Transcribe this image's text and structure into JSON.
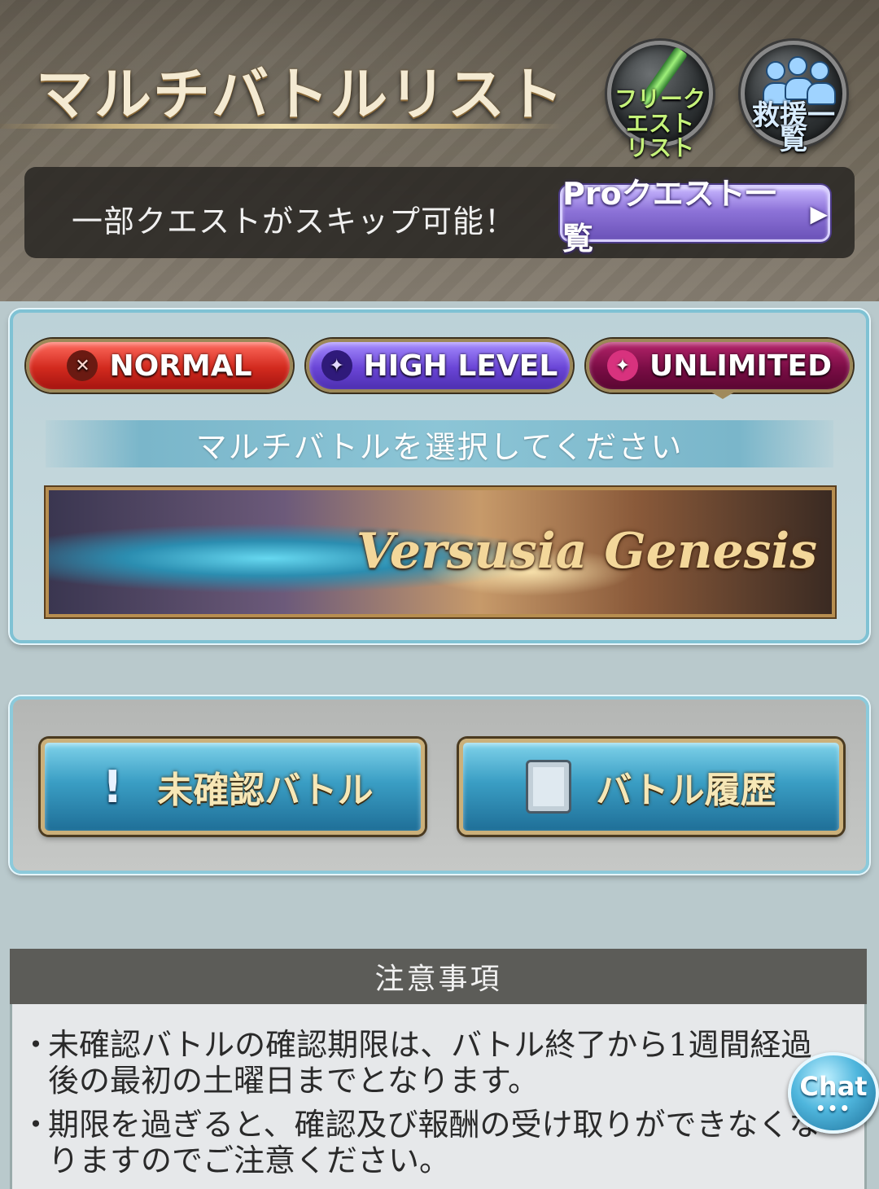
{
  "header": {
    "title": "マルチバトルリスト",
    "free_quest_label": "フリークエスト\nリスト",
    "rescue_label": "救援一覧"
  },
  "skip_bar": {
    "text": "一部クエストがスキップ可能！",
    "pro_button_label": "Proクエスト一覧",
    "pro_button_arrow": "▶"
  },
  "tabs": [
    {
      "label": "NORMAL",
      "icon": "crossed-swords-icon",
      "color": "#d22a1e"
    },
    {
      "label": "HIGH LEVEL",
      "icon": "dragon-icon",
      "color": "#6a45d6"
    },
    {
      "label": "UNLIMITED",
      "icon": "dragon-icon",
      "color": "#7a0d45",
      "selected": true
    }
  ],
  "select_prompt": "マルチバトルを選択してください",
  "event_banner": {
    "title": "Versusia Genesis"
  },
  "actions": {
    "unconfirmed_label": "未確認バトル",
    "history_label": "バトル履歴"
  },
  "notes": {
    "header": "注意事項",
    "items": [
      "未確認バトルの確認期限は、バトル終了から1週間経過後の最初の土曜日までとなります。",
      "期限を過ぎると、確認及び報酬の受け取りができなくなりますのでご注意ください。"
    ]
  },
  "chat": {
    "label": "Chat",
    "dots": "•••"
  },
  "colors": {
    "accent_blue": "#3a9ec4",
    "panel_border": "#7fc2d4",
    "pro_purple": "#8d73d8"
  }
}
